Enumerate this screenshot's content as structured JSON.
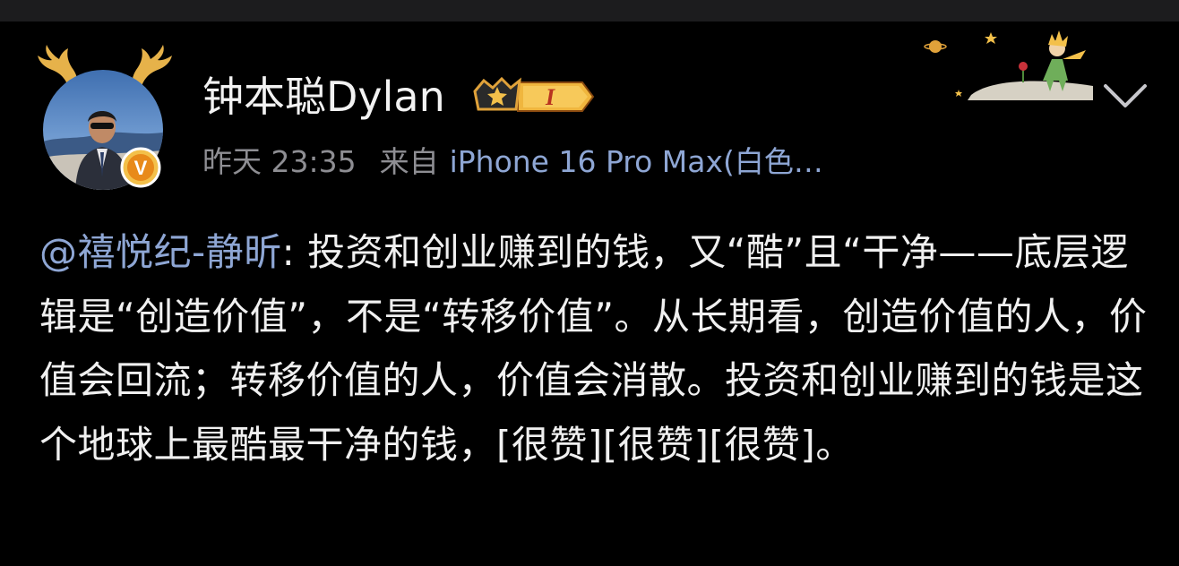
{
  "post": {
    "author": {
      "name": "钟本聪Dylan",
      "rank_badge_text": "I",
      "verified_badge_text": "V"
    },
    "timestamp": "昨天 23:35",
    "source_prefix": "来自",
    "source_device": "iPhone 16 Pro Max(白色…",
    "body": {
      "mention": "@禧悦纪-静昕",
      "text": ": 投资和创业赚到的钱，又“酷”且“干净——底层逻辑是“创造价值”，不是“转移价值”。从长期看，创造价值的人，价值会回流；转移价值的人，价值会消散。投资和创业赚到的钱是这个地球上最酷最干净的钱，[很赞][很赞][很赞]。"
    }
  },
  "colors": {
    "background": "#000000",
    "text_primary": "#f0f0f0",
    "text_secondary": "#8e8e93",
    "link": "#8ea6d4",
    "badge_gold": "#e0a23a",
    "badge_red": "#b8321f"
  },
  "icons": {
    "antlers": "antler-icon",
    "verified": "verified-v-icon",
    "rank": "crown-rank-icon",
    "decoration": "little-prince-decoration",
    "menu": "chevron-down-icon"
  }
}
